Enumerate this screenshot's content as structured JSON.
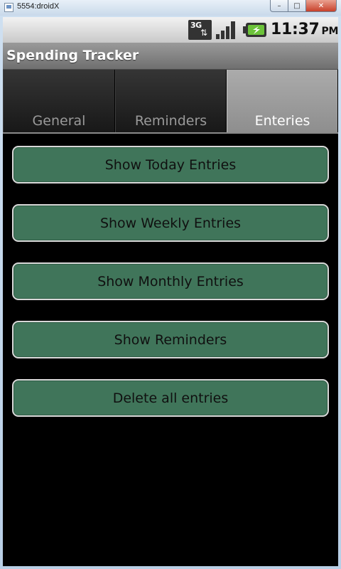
{
  "window": {
    "title": "5554:droidX",
    "minimize_glyph": "–",
    "maximize_glyph": "□",
    "close_glyph": "✕"
  },
  "statusbar": {
    "network_label": "3G",
    "network_arrows": "⇅",
    "time": "11:37",
    "ampm": "PM",
    "icons": [
      "network-3g-icon",
      "signal-icon",
      "battery-charging-icon"
    ]
  },
  "app": {
    "title": "Spending Tracker"
  },
  "tabs": [
    {
      "label": "General",
      "selected": false
    },
    {
      "label": "Reminders",
      "selected": false
    },
    {
      "label": "Enteries",
      "selected": true
    }
  ],
  "buttons": [
    {
      "label": "Show Today Entries"
    },
    {
      "label": "Show Weekly Entries"
    },
    {
      "label": "Show Monthly Entries"
    },
    {
      "label": "Show Reminders"
    },
    {
      "label": "Delete all entries"
    }
  ],
  "colors": {
    "button_fill": "#40755a",
    "button_border": "#d8d8d8",
    "tab_selected": "#9e9e9e",
    "tab_unselected": "#262626",
    "battery_green": "#6cc33a"
  }
}
